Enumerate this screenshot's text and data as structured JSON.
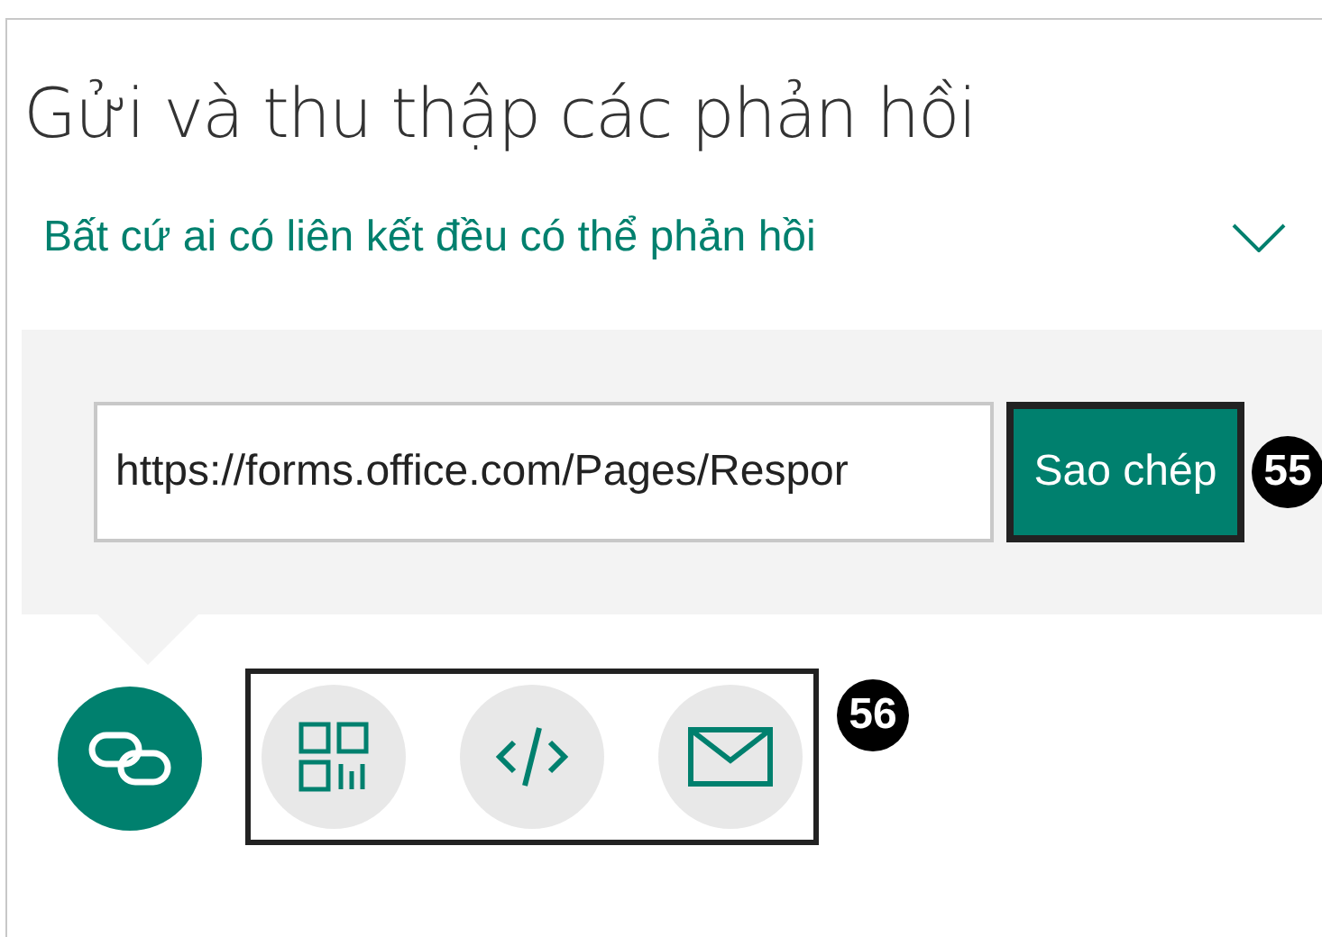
{
  "title": "Gửi và thu thập các phản hồi",
  "audience": {
    "label": "Bất cứ ai có liên kết đều có thể phản hồi"
  },
  "link": {
    "value": "https://forms.office.com/Pages/Respor",
    "button": "Sao chép",
    "badge": "55"
  },
  "share_options": [
    {
      "kind": "link",
      "selected": true
    },
    {
      "kind": "qr",
      "selected": false
    },
    {
      "kind": "embed",
      "selected": false
    },
    {
      "kind": "email",
      "selected": false
    }
  ],
  "share_badge": "56"
}
